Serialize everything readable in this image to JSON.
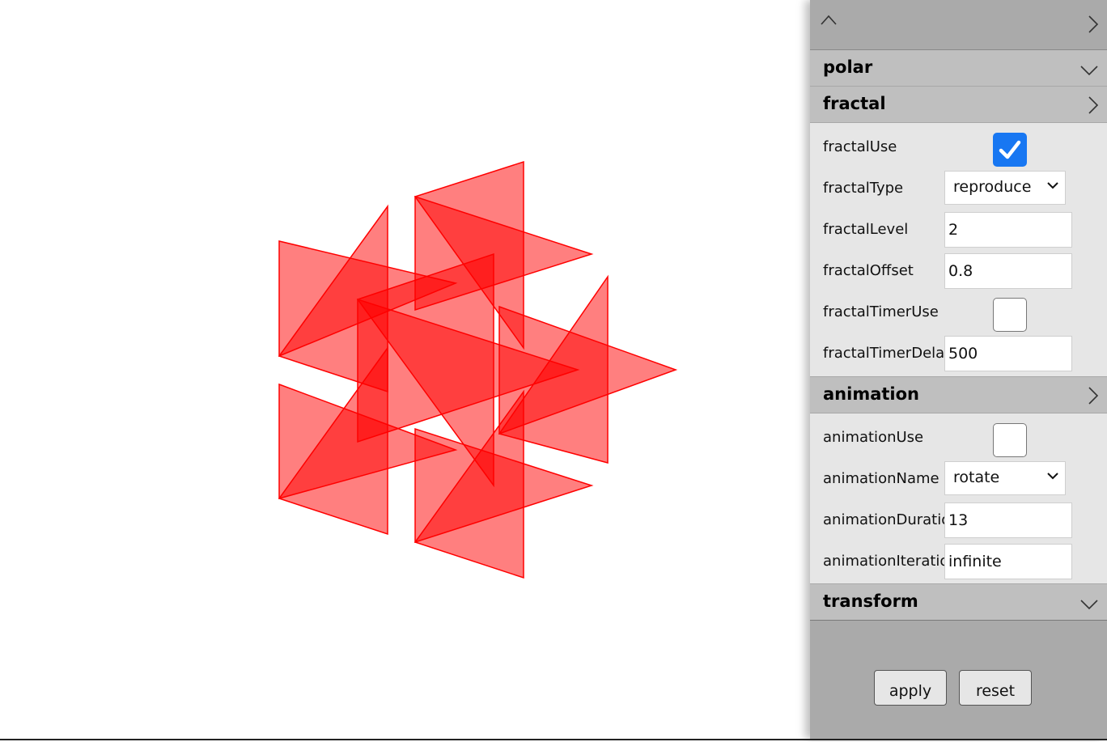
{
  "panel": {
    "sections": {
      "polar": {
        "title": "polar"
      },
      "fractal": {
        "title": "fractal",
        "fields": {
          "fractalUse": {
            "label": "fractalUse",
            "checked": true
          },
          "fractalType": {
            "label": "fractalType",
            "value": "reproduce"
          },
          "fractalLevel": {
            "label": "fractalLevel",
            "value": "2"
          },
          "fractalOffset": {
            "label": "fractalOffset",
            "value": "0.8"
          },
          "fractalTimerUse": {
            "label": "fractalTimerUse",
            "checked": false
          },
          "fractalTimerDelay": {
            "label": "fractalTimerDelay",
            "value": "500"
          }
        }
      },
      "animation": {
        "title": "animation",
        "fields": {
          "animationUse": {
            "label": "animationUse",
            "checked": false
          },
          "animationName": {
            "label": "animationName",
            "value": "rotate"
          },
          "animationDuration": {
            "label": "animationDuratio",
            "value": "13"
          },
          "animationIteration": {
            "label": "animationIteratio",
            "value": "infinite"
          }
        }
      },
      "transform": {
        "title": "transform"
      }
    },
    "buttons": {
      "apply": "apply",
      "reset": "reset"
    }
  },
  "colors": {
    "shape_fill": "#ff7b7b",
    "shape_stroke": "#ff0000",
    "checkbox_checked": "#1877f2",
    "panel_bg": "#aaaaaa",
    "section_header_bg": "#bfbfbf",
    "section_body_bg": "#e6e6e6"
  }
}
